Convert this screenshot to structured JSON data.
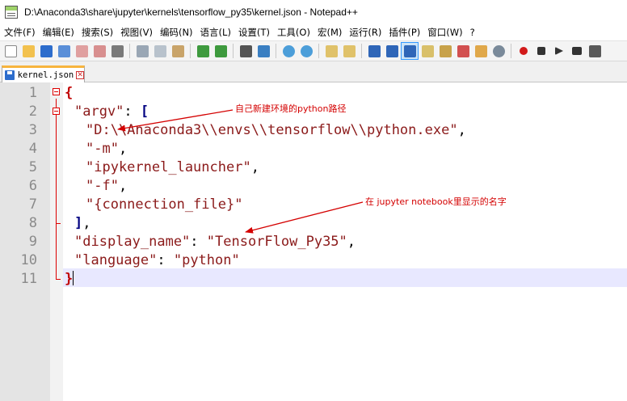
{
  "window": {
    "title": "D:\\Anaconda3\\share\\jupyter\\kernels\\tensorflow_py35\\kernel.json - Notepad++"
  },
  "menu": [
    "文件(F)",
    "编辑(E)",
    "搜索(S)",
    "视图(V)",
    "编码(N)",
    "语言(L)",
    "设置(T)",
    "工具(O)",
    "宏(M)",
    "运行(R)",
    "插件(P)",
    "窗口(W)",
    "?"
  ],
  "tab": {
    "label": "kernel.json",
    "close": "✕"
  },
  "line_numbers": [
    "1",
    "2",
    "3",
    "4",
    "5",
    "6",
    "7",
    "8",
    "9",
    "10",
    "11"
  ],
  "code": {
    "l1_open": "{",
    "l2_key": "\"argv\"",
    "l2_colon": ": ",
    "l2_bracket": "[",
    "l3_str": "\"D:\\\\Anaconda3\\\\envs\\\\tensorflow\\\\python.exe\"",
    "l3_comma": ",",
    "l4_str": "\"-m\"",
    "l4_comma": ",",
    "l5_str": "\"ipykernel_launcher\"",
    "l5_comma": ",",
    "l6_str": "\"-f\"",
    "l6_comma": ",",
    "l7_str": "\"{connection_file}\"",
    "l8_bracket": "]",
    "l8_comma": ",",
    "l9_key": "\"display_name\"",
    "l9_colon": ": ",
    "l9_str": "\"TensorFlow_Py35\"",
    "l9_comma": ",",
    "l10_key": "\"language\"",
    "l10_colon": ": ",
    "l10_str": "\"python\"",
    "l11_close": "}"
  },
  "annotations": {
    "a1": "自己新建环境的python路径",
    "a2": "在 jupyter notebook里显示的名字"
  },
  "colors": {
    "string": "#8b1a1a",
    "brace": "#c00000",
    "annotation": "#d40000"
  }
}
